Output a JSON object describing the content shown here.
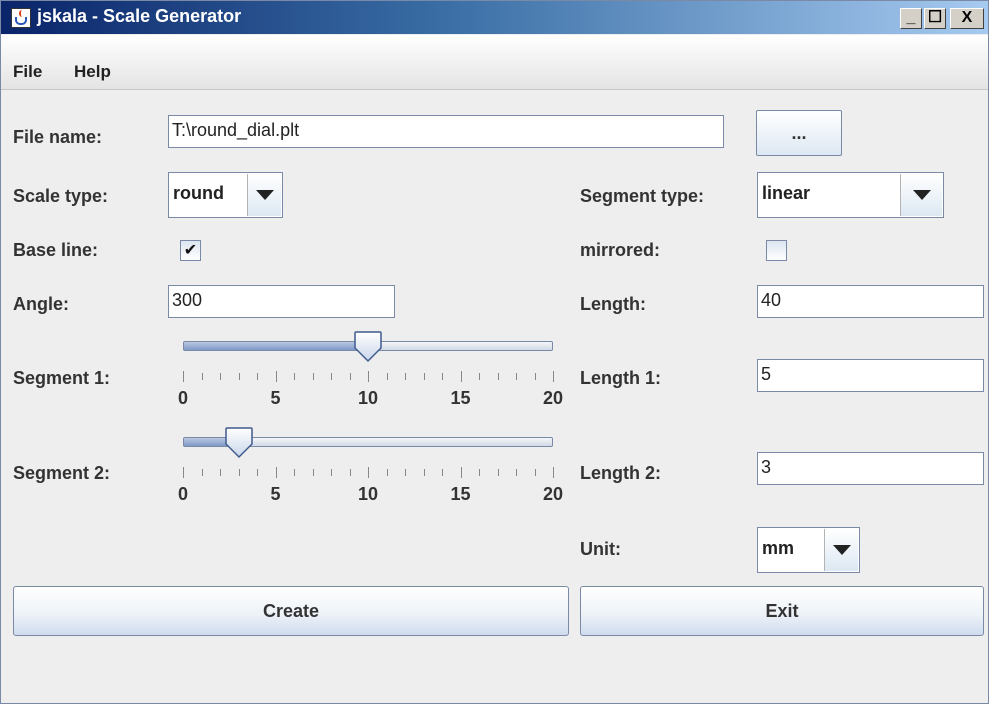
{
  "window": {
    "title": "jskala - Scale Generator",
    "icon": "java-cup-icon",
    "controls": {
      "minimize": "_",
      "maximize": "☐",
      "close": "X"
    }
  },
  "menu": [
    "File",
    "Help"
  ],
  "file_name": {
    "label": "File name:",
    "value": "T:\\round_dial.plt",
    "browse_label": "..."
  },
  "scale_type": {
    "label": "Scale type:",
    "value": "round"
  },
  "segment_type": {
    "label": "Segment type:",
    "value": "linear"
  },
  "base_line": {
    "label": "Base line:",
    "checked": true,
    "check_glyph": "✔"
  },
  "mirrored": {
    "label": "mirrored:",
    "checked": false
  },
  "angle": {
    "label": "Angle:",
    "value": "300"
  },
  "length": {
    "label": "Length:",
    "value": "40"
  },
  "segment1": {
    "label": "Segment 1:",
    "value": 10,
    "min": 0,
    "max": 20,
    "tick_labels": [
      "0",
      "5",
      "10",
      "15",
      "20"
    ]
  },
  "segment2": {
    "label": "Segment 2:",
    "value": 3,
    "min": 0,
    "max": 20,
    "tick_labels": [
      "0",
      "5",
      "10",
      "15",
      "20"
    ]
  },
  "length1": {
    "label": "Length 1:",
    "value": "5"
  },
  "length2": {
    "label": "Length 2:",
    "value": "3"
  },
  "unit": {
    "label": "Unit:",
    "value": "mm"
  },
  "buttons": {
    "create": "Create",
    "exit": "Exit"
  }
}
